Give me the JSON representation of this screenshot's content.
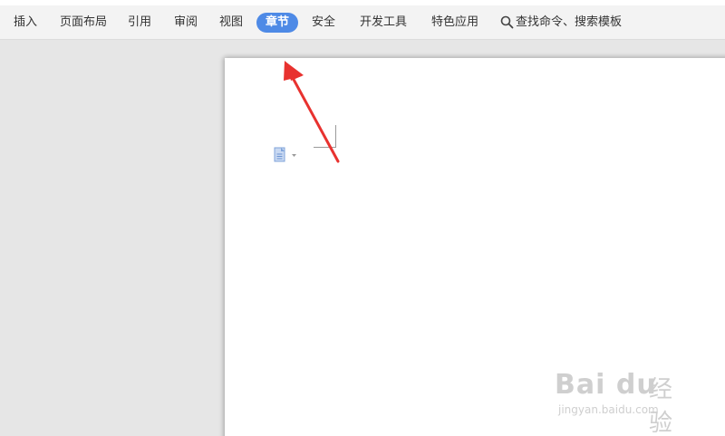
{
  "menubar": {
    "items": [
      {
        "label": "插入"
      },
      {
        "label": "页面布局"
      },
      {
        "label": "引用"
      },
      {
        "label": "审阅"
      },
      {
        "label": "视图"
      },
      {
        "label": "章节",
        "active": true
      },
      {
        "label": "安全"
      },
      {
        "label": "开发工具"
      },
      {
        "label": "特色应用"
      }
    ],
    "search_label": "查找命令、搜索模板"
  },
  "colors": {
    "active_tab": "#4e8ae6",
    "annotation_arrow": "#e8322f"
  },
  "watermark": {
    "brand": "Bai du",
    "suffix": "经验",
    "url": "jingyan.baidu.com"
  }
}
